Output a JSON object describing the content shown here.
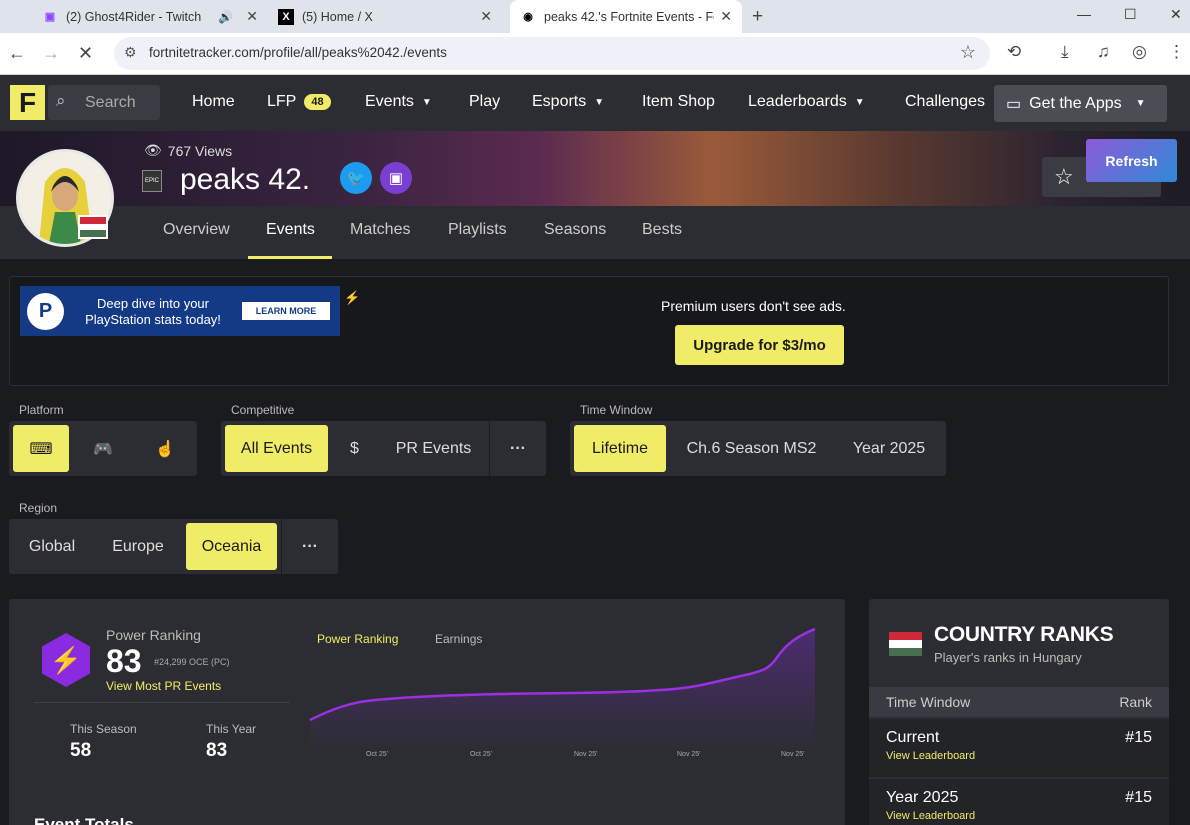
{
  "browser": {
    "tabs": [
      {
        "title": "(2) Ghost4Rider - Twitch",
        "favicon": "twitch-icon"
      },
      {
        "title": "(5) Home / X",
        "favicon": "x-icon"
      },
      {
        "title": "peaks 42.'s Fortnite Events - For",
        "favicon": "tracker-icon"
      }
    ],
    "url": "fortnitetracker.com/profile/all/peaks%2042./events"
  },
  "site": {
    "logo": "F",
    "search_placeholder": "Search",
    "nav": [
      "Home",
      "LFP",
      "Events",
      "Play",
      "Esports",
      "Item Shop",
      "Leaderboards",
      "Challenges"
    ],
    "lfp_badge": "48",
    "get_apps": "Get the Apps"
  },
  "profile": {
    "views": "767 Views",
    "name": "peaks 42.",
    "epic_label": "EPIC",
    "favorite": "Favorite",
    "refresh": "Refresh",
    "tabs": [
      "Overview",
      "Events",
      "Matches",
      "Playlists",
      "Seasons",
      "Bests"
    ],
    "active_tab": "Events"
  },
  "ad": {
    "banner_text": "Deep dive into your PlayStation stats today!",
    "learn_more": "LEARN MORE",
    "premium_text": "Premium users don't see ads.",
    "upgrade": "Upgrade for $3/mo"
  },
  "filters": {
    "platform_label": "Platform",
    "competitive_label": "Competitive",
    "competitive_options": [
      "All Events",
      "$",
      "PR Events",
      "···"
    ],
    "time_label": "Time Window",
    "time_options": [
      "Lifetime",
      "Ch.6 Season MS2",
      "Year 2025"
    ],
    "region_label": "Region",
    "region_options": [
      "Global",
      "Europe",
      "Oceania",
      "···"
    ]
  },
  "power_ranking": {
    "label": "Power Ranking",
    "value": "83",
    "rank_detail": "#24,299 OCE (PC)",
    "link": "View Most PR Events",
    "this_season_label": "This Season",
    "this_season_value": "58",
    "this_year_label": "This Year",
    "this_year_value": "83",
    "chart_tabs": [
      "Power Ranking",
      "Earnings"
    ],
    "x_ticks": [
      "Oct 25'",
      "Oct 25'",
      "Nov 25'",
      "Nov 25'",
      "Nov 25'"
    ]
  },
  "event_totals": "Event Totals",
  "country_ranks": {
    "title": "COUNTRY RANKS",
    "subtitle": "Player's ranks in Hungary",
    "col_time": "Time Window",
    "col_rank": "Rank",
    "rows": [
      {
        "name": "Current",
        "link": "View Leaderboard",
        "rank": "#15"
      },
      {
        "name": "Year 2025",
        "link": "View Leaderboard",
        "rank": "#15"
      }
    ]
  },
  "colors": {
    "accent": "#f1ec67",
    "purple": "#8a2be2",
    "bg": "#1a1b1f",
    "card": "#2c2d33"
  }
}
